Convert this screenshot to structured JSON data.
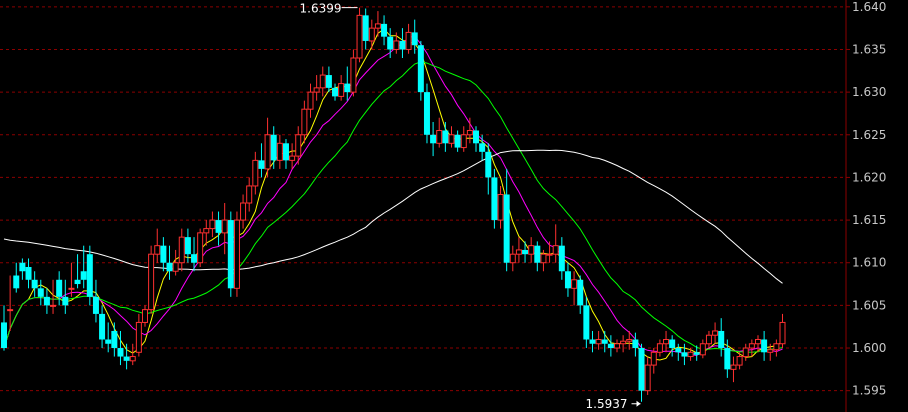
{
  "chart_data": {
    "type": "candlestick",
    "title": "",
    "xlabel": "",
    "ylabel": "",
    "ylim": [
      1.5925,
      1.6408
    ],
    "y_ticks": [
      "1.640",
      "1.635",
      "1.630",
      "1.625",
      "1.620",
      "1.615",
      "1.610",
      "1.605",
      "1.600",
      "1.595"
    ],
    "grid": "horizontal-dashed",
    "annotations": {
      "high": {
        "label": "1.6399",
        "value": 1.6399,
        "bar": 58
      },
      "low": {
        "label": "1.5937",
        "value": 1.5937,
        "bar": 104
      }
    },
    "candles": [
      [
        1.603,
        1.605,
        1.6,
        1.5997
      ],
      [
        1.6045,
        1.6085,
        1.6045,
        1.602
      ],
      [
        1.6085,
        1.61,
        1.607,
        1.6065
      ],
      [
        1.61,
        1.6105,
        1.609,
        1.608
      ],
      [
        1.6095,
        1.6105,
        1.608,
        1.607
      ],
      [
        1.608,
        1.609,
        1.607,
        1.606
      ],
      [
        1.607,
        1.608,
        1.606,
        1.605
      ],
      [
        1.606,
        1.607,
        1.605,
        1.604
      ],
      [
        1.605,
        1.608,
        1.605,
        1.604
      ],
      [
        1.608,
        1.609,
        1.606,
        1.605
      ],
      [
        1.606,
        1.608,
        1.605,
        1.604
      ],
      [
        1.607,
        1.61,
        1.607,
        1.606
      ],
      [
        1.608,
        1.611,
        1.6075,
        1.607
      ],
      [
        1.609,
        1.612,
        1.608,
        1.607
      ],
      [
        1.611,
        1.612,
        1.606,
        1.605
      ],
      [
        1.606,
        1.608,
        1.604,
        1.603
      ],
      [
        1.604,
        1.605,
        1.601,
        1.6
      ],
      [
        1.601,
        1.603,
        1.6005,
        1.5995
      ],
      [
        1.602,
        1.603,
        1.6,
        1.599
      ],
      [
        1.6,
        1.602,
        1.599,
        1.598
      ],
      [
        1.599,
        1.6005,
        1.5985,
        1.5975
      ],
      [
        1.5985,
        1.6005,
        1.599,
        1.598
      ],
      [
        1.5995,
        1.604,
        1.603,
        1.599
      ],
      [
        1.603,
        1.605,
        1.6045,
        1.6025
      ],
      [
        1.6045,
        1.612,
        1.611,
        1.604
      ],
      [
        1.611,
        1.614,
        1.612,
        1.61
      ],
      [
        1.612,
        1.613,
        1.61,
        1.609
      ],
      [
        1.61,
        1.612,
        1.609,
        1.608
      ],
      [
        1.609,
        1.6115,
        1.61,
        1.6085
      ],
      [
        1.61,
        1.614,
        1.613,
        1.609
      ],
      [
        1.613,
        1.614,
        1.611,
        1.61
      ],
      [
        1.611,
        1.613,
        1.61,
        1.609
      ],
      [
        1.61,
        1.614,
        1.6135,
        1.6095
      ],
      [
        1.6135,
        1.615,
        1.614,
        1.612
      ],
      [
        1.614,
        1.616,
        1.615,
        1.613
      ],
      [
        1.615,
        1.616,
        1.6135,
        1.612
      ],
      [
        1.6135,
        1.617,
        1.615,
        1.611
      ],
      [
        1.615,
        1.616,
        1.607,
        1.606
      ],
      [
        1.607,
        1.616,
        1.615,
        1.606
      ],
      [
        1.615,
        1.618,
        1.617,
        1.614
      ],
      [
        1.617,
        1.62,
        1.619,
        1.616
      ],
      [
        1.619,
        1.623,
        1.622,
        1.618
      ],
      [
        1.622,
        1.624,
        1.621,
        1.62
      ],
      [
        1.621,
        1.627,
        1.625,
        1.62
      ],
      [
        1.625,
        1.626,
        1.622,
        1.621
      ],
      [
        1.622,
        1.625,
        1.624,
        1.621
      ],
      [
        1.624,
        1.6245,
        1.622,
        1.621
      ],
      [
        1.622,
        1.624,
        1.6225,
        1.621
      ],
      [
        1.6225,
        1.626,
        1.625,
        1.6215
      ],
      [
        1.625,
        1.629,
        1.628,
        1.624
      ],
      [
        1.628,
        1.631,
        1.63,
        1.627
      ],
      [
        1.63,
        1.632,
        1.6305,
        1.629
      ],
      [
        1.6305,
        1.633,
        1.632,
        1.6295
      ],
      [
        1.632,
        1.633,
        1.6305,
        1.63
      ],
      [
        1.6305,
        1.631,
        1.6295,
        1.629
      ],
      [
        1.6295,
        1.632,
        1.631,
        1.629
      ],
      [
        1.631,
        1.633,
        1.63,
        1.629
      ],
      [
        1.63,
        1.635,
        1.634,
        1.6295
      ],
      [
        1.634,
        1.6399,
        1.639,
        1.6335
      ],
      [
        1.639,
        1.6398,
        1.636,
        1.635
      ],
      [
        1.636,
        1.6385,
        1.6375,
        1.635
      ],
      [
        1.6375,
        1.6395,
        1.638,
        1.6365
      ],
      [
        1.638,
        1.639,
        1.6365,
        1.6355
      ],
      [
        1.6365,
        1.6375,
        1.635,
        1.634
      ],
      [
        1.635,
        1.637,
        1.636,
        1.6345
      ],
      [
        1.636,
        1.6375,
        1.635,
        1.634
      ],
      [
        1.635,
        1.638,
        1.637,
        1.6345
      ],
      [
        1.637,
        1.6385,
        1.6355,
        1.6345
      ],
      [
        1.6355,
        1.636,
        1.63,
        1.629
      ],
      [
        1.63,
        1.631,
        1.625,
        1.624
      ],
      [
        1.625,
        1.6265,
        1.624,
        1.6225
      ],
      [
        1.624,
        1.627,
        1.6255,
        1.6235
      ],
      [
        1.6255,
        1.6265,
        1.624,
        1.623
      ],
      [
        1.624,
        1.626,
        1.625,
        1.6235
      ],
      [
        1.625,
        1.6255,
        1.6235,
        1.623
      ],
      [
        1.6235,
        1.626,
        1.625,
        1.623
      ],
      [
        1.625,
        1.627,
        1.6255,
        1.624
      ],
      [
        1.6255,
        1.626,
        1.624,
        1.623
      ],
      [
        1.624,
        1.625,
        1.623,
        1.622
      ],
      [
        1.623,
        1.624,
        1.62,
        1.618
      ],
      [
        1.62,
        1.621,
        1.615,
        1.614
      ],
      [
        1.615,
        1.619,
        1.618,
        1.614
      ],
      [
        1.618,
        1.621,
        1.61,
        1.609
      ],
      [
        1.61,
        1.612,
        1.611,
        1.609
      ],
      [
        1.611,
        1.613,
        1.6115,
        1.61
      ],
      [
        1.6115,
        1.6125,
        1.611,
        1.61
      ],
      [
        1.611,
        1.613,
        1.612,
        1.61
      ],
      [
        1.612,
        1.6125,
        1.61,
        1.609
      ],
      [
        1.61,
        1.6115,
        1.611,
        1.609
      ],
      [
        1.611,
        1.6125,
        1.611,
        1.61
      ],
      [
        1.611,
        1.6145,
        1.612,
        1.61
      ],
      [
        1.612,
        1.613,
        1.609,
        1.608
      ],
      [
        1.609,
        1.61,
        1.607,
        1.606
      ],
      [
        1.607,
        1.609,
        1.608,
        1.605
      ],
      [
        1.608,
        1.6085,
        1.605,
        1.604
      ],
      [
        1.605,
        1.606,
        1.601,
        1.6
      ],
      [
        1.601,
        1.602,
        1.6005,
        1.5995
      ],
      [
        1.6005,
        1.602,
        1.601,
        1.5998
      ],
      [
        1.601,
        1.602,
        1.6005,
        1.5995
      ],
      [
        1.6005,
        1.6015,
        1.6,
        1.599
      ],
      [
        1.6,
        1.601,
        1.6005,
        1.5995
      ],
      [
        1.6005,
        1.6015,
        1.6008,
        1.5995
      ],
      [
        1.6008,
        1.602,
        1.601,
        1.5998
      ],
      [
        1.601,
        1.6018,
        1.6,
        1.599
      ],
      [
        1.6,
        1.6005,
        1.595,
        1.5937
      ],
      [
        1.595,
        1.599,
        1.598,
        1.5945
      ],
      [
        1.598,
        1.6,
        1.5995,
        1.597
      ],
      [
        1.5995,
        1.601,
        1.6005,
        1.599
      ],
      [
        1.6005,
        1.602,
        1.601,
        1.5995
      ],
      [
        1.601,
        1.6015,
        1.6,
        1.599
      ],
      [
        1.6,
        1.6005,
        1.5995,
        1.5985
      ],
      [
        1.5995,
        1.6005,
        1.599,
        1.598
      ],
      [
        1.599,
        1.6,
        1.5995,
        1.5985
      ],
      [
        1.5995,
        1.6003,
        1.5992,
        1.5985
      ],
      [
        1.5992,
        1.601,
        1.6005,
        1.5988
      ],
      [
        1.6005,
        1.602,
        1.6015,
        1.6
      ],
      [
        1.6015,
        1.603,
        1.602,
        1.6005
      ],
      [
        1.602,
        1.6035,
        1.6,
        1.599
      ],
      [
        1.6,
        1.601,
        1.5975,
        1.5965
      ],
      [
        1.5975,
        1.599,
        1.598,
        1.596
      ],
      [
        1.598,
        1.5995,
        1.599,
        1.5975
      ],
      [
        1.599,
        1.6005,
        1.6,
        1.5985
      ],
      [
        1.6,
        1.601,
        1.6005,
        1.599
      ],
      [
        1.6005,
        1.6015,
        1.601,
        1.5995
      ],
      [
        1.601,
        1.602,
        1.5995,
        1.5985
      ],
      [
        1.5995,
        1.6005,
        1.5998,
        1.5985
      ],
      [
        1.5998,
        1.601,
        1.6005,
        1.599
      ],
      [
        1.6005,
        1.604,
        1.603,
        1.6
      ]
    ],
    "ma_series": [
      {
        "color": "#ffff00",
        "period": 5
      },
      {
        "color": "#ff00ff",
        "period": 10
      },
      {
        "color": "#00ff00",
        "period": 20
      },
      {
        "color": "#ffffff",
        "period": 60,
        "seed": 1.613
      }
    ],
    "colors": {
      "up": "#ff3030",
      "down": "#00ffff",
      "grid": "#8b0000",
      "background": "#000000"
    }
  }
}
